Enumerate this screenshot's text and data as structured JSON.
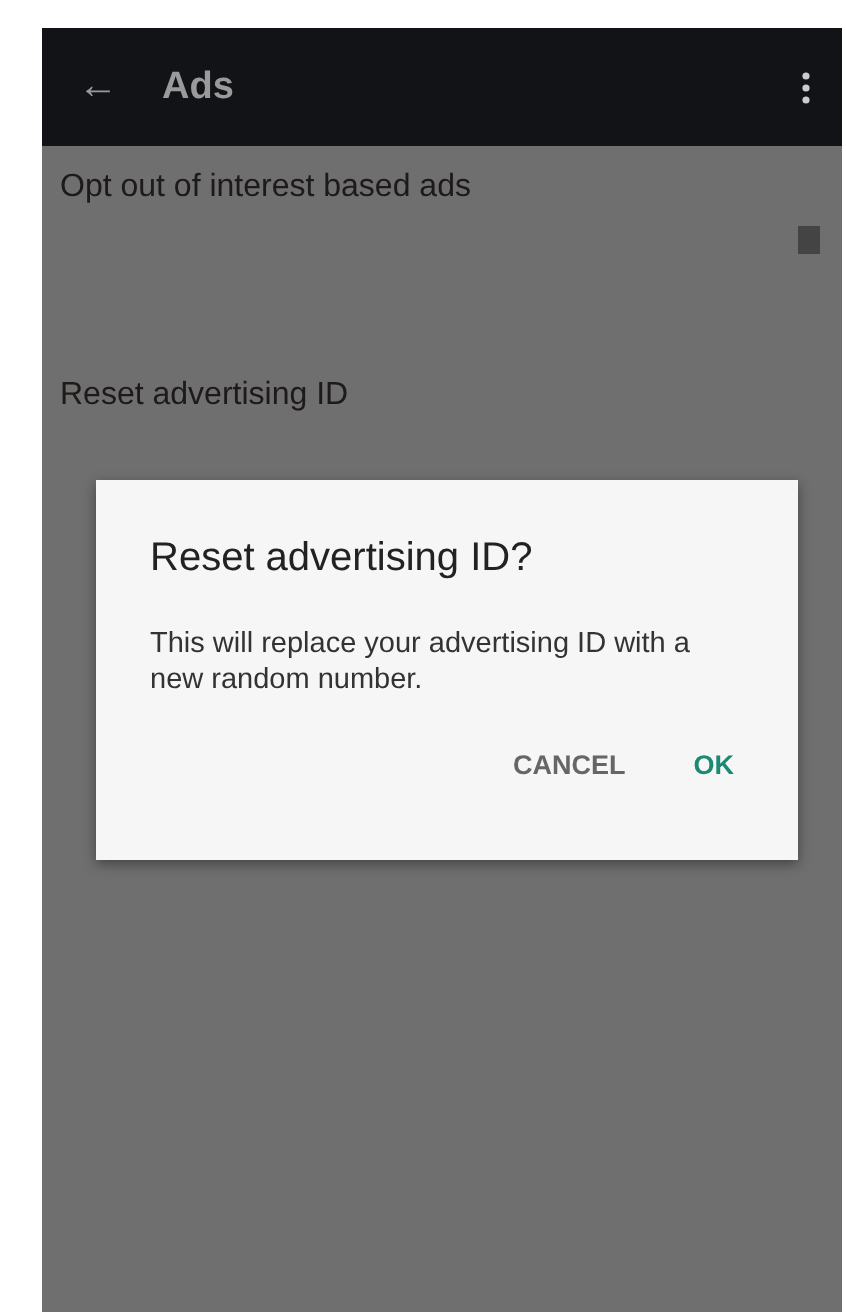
{
  "toolbar": {
    "back_icon": "←",
    "title": "Ads"
  },
  "settings": [
    {
      "kind": "checkbox",
      "title": "Opt out of interest based ads",
      "checked": false
    },
    {
      "kind": "plain",
      "title": "Reset advertising ID"
    }
  ],
  "dialog": {
    "title": "Reset advertising ID?",
    "message": "This will replace your advertising ID with a new random number.",
    "buttons": [
      {
        "label": "CANCEL",
        "kind": "neutral"
      },
      {
        "label": "OK",
        "kind": "primary"
      }
    ]
  }
}
